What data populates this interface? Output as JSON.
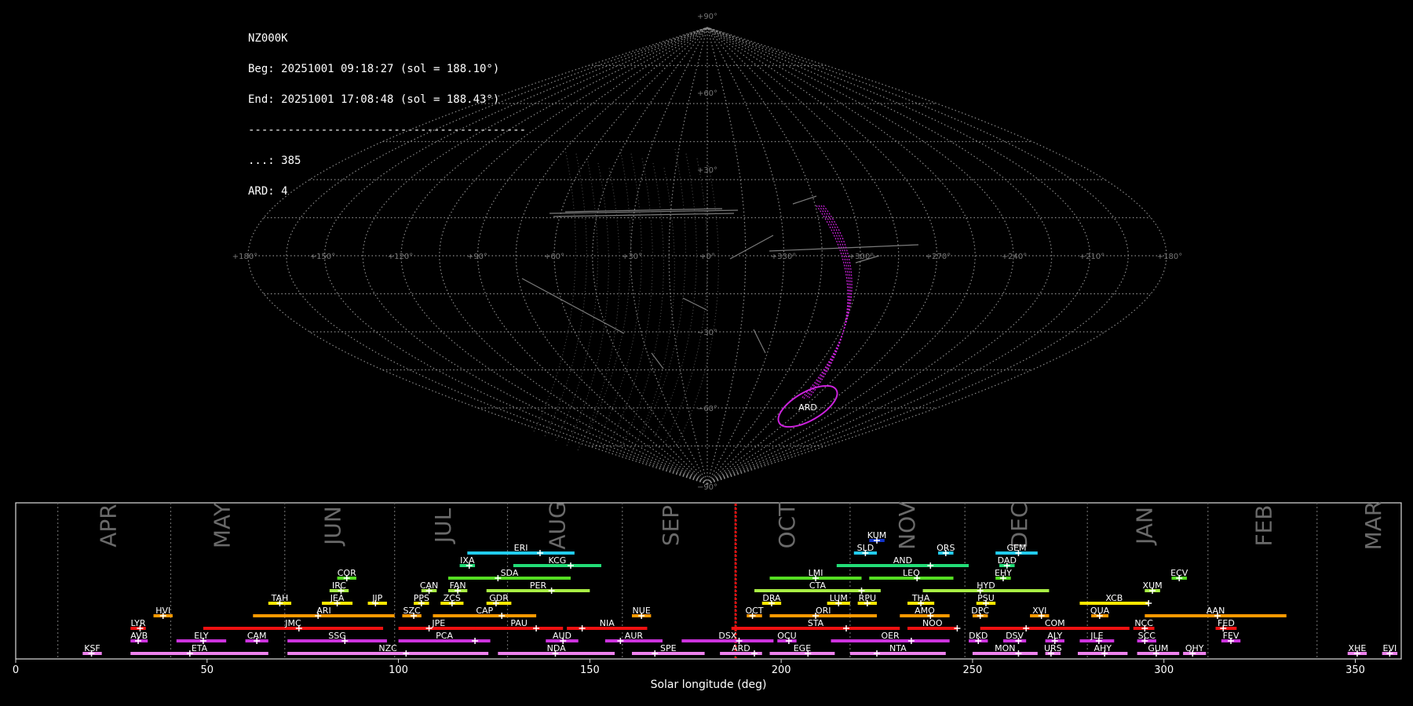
{
  "station": "NZ000K",
  "begin_line": "Beg: 20251001 09:18:27 (sol = 188.10°)",
  "end_line": "End: 20251001 17:08:48 (sol = 188.43°)",
  "separator": "------------------------------------------",
  "count_lines": [
    "...: 385",
    "ARD: 4"
  ],
  "colors": {
    "background": "#000000",
    "grid": "#8a8a8a",
    "tracks": "#9a9a9a",
    "ard": "#cc22dd",
    "current_sol": "#dd1111",
    "month": "#6a6a6a"
  },
  "chart_data": [
    {
      "type": "scatter",
      "projection": "sinusoidal sky map",
      "lon_ticks": [
        "+180°",
        "+150°",
        "+120°",
        "+90°",
        "+60°",
        "+30°",
        "+0°",
        "+330°",
        "+300°",
        "+270°",
        "+240°",
        "+210°",
        "+180°"
      ],
      "lat_ticks": [
        "+90°",
        "+60°",
        "+30°",
        "−30°",
        "−60°",
        "−90°"
      ],
      "grid": true,
      "highlighted_shower": {
        "code": "ARD",
        "ra_deg": 335,
        "dec_deg": -61,
        "count": 4
      },
      "meteor_count": 385
    },
    {
      "type": "bar",
      "title": "",
      "xlabel": "Solar longitude (deg)",
      "ylabel": "",
      "xlim": [
        0,
        362
      ],
      "x_ticks": [
        0,
        50,
        100,
        150,
        200,
        250,
        300,
        350
      ],
      "month_labels": [
        {
          "name": "APR",
          "sol": 24.5
        },
        {
          "name": "MAY",
          "sol": 54.2
        },
        {
          "name": "JUN",
          "sol": 83.2
        },
        {
          "name": "JUL",
          "sol": 112
        },
        {
          "name": "AUG",
          "sol": 141.8
        },
        {
          "name": "SEP",
          "sol": 171.5
        },
        {
          "name": "OCT",
          "sol": 201.8
        },
        {
          "name": "NOV",
          "sol": 233.2
        },
        {
          "name": "DEC",
          "sol": 262.5
        },
        {
          "name": "JAN",
          "sol": 295.2
        },
        {
          "name": "FEB",
          "sol": 326.4
        },
        {
          "name": "MAR",
          "sol": 355
        }
      ],
      "month_boundaries": [
        11,
        40.5,
        70.3,
        99,
        128.5,
        158.5,
        188,
        218,
        248,
        280,
        311.5,
        340
      ],
      "current_sol": 188.1,
      "series": [
        {
          "code": "KSF",
          "row": 0,
          "start": 17.5,
          "end": 22.5,
          "peak": 19.8,
          "color": "#ee82ee"
        },
        {
          "code": "ETA",
          "row": 0,
          "start": 30,
          "end": 66,
          "peak": 45.5,
          "color": "#ee82ee"
        },
        {
          "code": "NZC",
          "row": 0,
          "start": 71,
          "end": 123.5,
          "peak": 102,
          "color": "#ee82ee"
        },
        {
          "code": "NDA",
          "row": 0,
          "start": 126,
          "end": 156.5,
          "peak": 141,
          "color": "#ee82ee"
        },
        {
          "code": "SPE",
          "row": 0,
          "start": 161,
          "end": 180,
          "peak": 167,
          "color": "#ee82ee"
        },
        {
          "code": "ARD",
          "row": 0,
          "start": 184,
          "end": 195,
          "peak": 193,
          "color": "#ee82ee"
        },
        {
          "code": "EGE",
          "row": 0,
          "start": 197,
          "end": 214,
          "peak": 207,
          "color": "#ee82ee"
        },
        {
          "code": "NTA",
          "row": 0,
          "start": 218,
          "end": 243,
          "peak": 225,
          "color": "#ee82ee"
        },
        {
          "code": "MON",
          "row": 0,
          "start": 250,
          "end": 267,
          "peak": 262,
          "color": "#ee82ee"
        },
        {
          "code": "URS",
          "row": 0,
          "start": 269,
          "end": 273,
          "peak": 270.5,
          "color": "#ee82ee"
        },
        {
          "code": "AHY",
          "row": 0,
          "start": 277.5,
          "end": 290.5,
          "peak": 284.5,
          "color": "#ee82ee"
        },
        {
          "code": "GUM",
          "row": 0,
          "start": 293,
          "end": 304,
          "peak": 298,
          "color": "#ee82ee"
        },
        {
          "code": "QHY",
          "row": 0,
          "start": 305,
          "end": 311,
          "peak": 307.5,
          "color": "#ee82ee"
        },
        {
          "code": "XHE",
          "row": 0,
          "start": 348,
          "end": 353,
          "peak": 350.5,
          "color": "#ee82ee"
        },
        {
          "code": "EVI",
          "row": 0,
          "start": 357,
          "end": 361,
          "peak": 359,
          "color": "#ee82ee"
        },
        {
          "code": "AVB",
          "row": 1,
          "start": 30,
          "end": 34.5,
          "peak": 32,
          "color": "#cc33dd"
        },
        {
          "code": "ELY",
          "row": 1,
          "start": 42,
          "end": 55,
          "peak": 49,
          "color": "#cc33dd"
        },
        {
          "code": "CAM",
          "row": 1,
          "start": 60,
          "end": 66,
          "peak": 63,
          "color": "#cc33dd"
        },
        {
          "code": "SSG",
          "row": 1,
          "start": 71,
          "end": 97,
          "peak": 86,
          "color": "#cc33dd"
        },
        {
          "code": "PCA",
          "row": 1,
          "start": 100,
          "end": 124,
          "peak": 120,
          "color": "#cc33dd"
        },
        {
          "code": "AUD",
          "row": 1,
          "start": 138.5,
          "end": 147,
          "peak": 143,
          "color": "#cc33dd"
        },
        {
          "code": "AUR",
          "row": 1,
          "start": 154,
          "end": 169,
          "peak": 158,
          "color": "#cc33dd"
        },
        {
          "code": "DSX",
          "row": 1,
          "start": 174,
          "end": 198,
          "peak": 189,
          "color": "#cc33dd"
        },
        {
          "code": "OCU",
          "row": 1,
          "start": 199,
          "end": 204,
          "peak": 202,
          "color": "#cc33dd"
        },
        {
          "code": "OER",
          "row": 1,
          "start": 213,
          "end": 244,
          "peak": 234,
          "color": "#cc33dd"
        },
        {
          "code": "DKD",
          "row": 1,
          "start": 249,
          "end": 254,
          "peak": 251.5,
          "color": "#cc33dd"
        },
        {
          "code": "DSV",
          "row": 1,
          "start": 258,
          "end": 264,
          "peak": 262,
          "color": "#cc33dd"
        },
        {
          "code": "ALY",
          "row": 1,
          "start": 269,
          "end": 274,
          "peak": 271.5,
          "color": "#cc33dd"
        },
        {
          "code": "JLE",
          "row": 1,
          "start": 278,
          "end": 287,
          "peak": 283,
          "color": "#cc33dd"
        },
        {
          "code": "SCC",
          "row": 1,
          "start": 293,
          "end": 298,
          "peak": 295,
          "color": "#cc33dd"
        },
        {
          "code": "FEV",
          "row": 1,
          "start": 315,
          "end": 320,
          "peak": 317.5,
          "color": "#cc33dd"
        },
        {
          "code": "LYR",
          "row": 2,
          "start": 30,
          "end": 34,
          "peak": 32.5,
          "color": "#ee1111"
        },
        {
          "code": "JMC",
          "row": 2,
          "start": 49,
          "end": 96,
          "peak": 74,
          "color": "#ee1111"
        },
        {
          "code": "JPE",
          "row": 2,
          "start": 100,
          "end": 121,
          "peak": 108,
          "color": "#ee1111"
        },
        {
          "code": "PAU",
          "row": 2,
          "start": 120,
          "end": 143,
          "peak": 136,
          "color": "#ee1111"
        },
        {
          "code": "NIA",
          "row": 2,
          "start": 144,
          "end": 165,
          "peak": 148,
          "color": "#ee1111"
        },
        {
          "code": "STA",
          "row": 2,
          "start": 187,
          "end": 231,
          "peak": 217,
          "color": "#ee1111"
        },
        {
          "code": "NOO",
          "row": 2,
          "start": 233,
          "end": 246,
          "peak": 246,
          "color": "#ee1111"
        },
        {
          "code": "COM",
          "row": 2,
          "start": 252,
          "end": 291,
          "peak": 264,
          "color": "#ee1111"
        },
        {
          "code": "NCC",
          "row": 2,
          "start": 292,
          "end": 297.5,
          "peak": 295,
          "color": "#ee1111"
        },
        {
          "code": "FED",
          "row": 2,
          "start": 313.5,
          "end": 319,
          "peak": 315.5,
          "color": "#ee1111"
        },
        {
          "code": "HVI",
          "row": 3,
          "start": 36,
          "end": 41,
          "peak": 38.5,
          "color": "#ff9a00"
        },
        {
          "code": "ARI",
          "row": 3,
          "start": 62,
          "end": 99,
          "peak": 79,
          "color": "#ff9a00"
        },
        {
          "code": "SZC",
          "row": 3,
          "start": 101,
          "end": 106,
          "peak": 104,
          "color": "#ff9a00"
        },
        {
          "code": "CAP",
          "row": 3,
          "start": 109,
          "end": 136,
          "peak": 127,
          "color": "#ff9a00"
        },
        {
          "code": "NUE",
          "row": 3,
          "start": 161,
          "end": 166,
          "peak": 163.5,
          "color": "#ff9a00"
        },
        {
          "code": "OCT",
          "row": 3,
          "start": 191,
          "end": 195,
          "peak": 192.5,
          "color": "#ff9a00"
        },
        {
          "code": "ORI",
          "row": 3,
          "start": 197,
          "end": 225,
          "peak": 209,
          "color": "#ff9a00"
        },
        {
          "code": "AMO",
          "row": 3,
          "start": 231,
          "end": 244,
          "peak": 239,
          "color": "#ff9a00"
        },
        {
          "code": "DPC",
          "row": 3,
          "start": 250,
          "end": 254,
          "peak": 252,
          "color": "#ff9a00"
        },
        {
          "code": "XVI",
          "row": 3,
          "start": 265,
          "end": 270,
          "peak": 268,
          "color": "#ff9a00"
        },
        {
          "code": "QUA",
          "row": 3,
          "start": 281,
          "end": 285.5,
          "peak": 283.2,
          "color": "#ff9a00"
        },
        {
          "code": "AAN",
          "row": 3,
          "start": 295,
          "end": 332,
          "peak": 314,
          "color": "#ff9a00"
        },
        {
          "code": "TAH",
          "row": 4,
          "start": 66,
          "end": 72,
          "peak": 69,
          "color": "#ffe800"
        },
        {
          "code": "JEA",
          "row": 4,
          "start": 80,
          "end": 88,
          "peak": 84,
          "color": "#ffe800"
        },
        {
          "code": "JIP",
          "row": 4,
          "start": 92,
          "end": 97,
          "peak": 94,
          "color": "#ffe800"
        },
        {
          "code": "PPS",
          "row": 4,
          "start": 104,
          "end": 108,
          "peak": 106,
          "color": "#ffe800"
        },
        {
          "code": "ZCS",
          "row": 4,
          "start": 111,
          "end": 117,
          "peak": 114,
          "color": "#ffe800"
        },
        {
          "code": "GDR",
          "row": 4,
          "start": 123,
          "end": 129.5,
          "peak": 125.5,
          "color": "#ffe800"
        },
        {
          "code": "DRA",
          "row": 4,
          "start": 195,
          "end": 200,
          "peak": 197.5,
          "color": "#ffe800"
        },
        {
          "code": "LUM",
          "row": 4,
          "start": 212,
          "end": 218,
          "peak": 215,
          "color": "#ffe800"
        },
        {
          "code": "RPU",
          "row": 4,
          "start": 220,
          "end": 225,
          "peak": 222.5,
          "color": "#ffe800"
        },
        {
          "code": "THA",
          "row": 4,
          "start": 233,
          "end": 240,
          "peak": 236.5,
          "color": "#ffe800"
        },
        {
          "code": "PSU",
          "row": 4,
          "start": 251,
          "end": 256,
          "peak": 253.5,
          "color": "#ffe800"
        },
        {
          "code": "XCB",
          "row": 4,
          "start": 278,
          "end": 296,
          "peak": 296,
          "color": "#ffe800"
        },
        {
          "code": "IRC",
          "row": 5,
          "start": 82,
          "end": 87,
          "peak": 85,
          "color": "#a8ee44"
        },
        {
          "code": "CAN",
          "row": 5,
          "start": 106,
          "end": 110,
          "peak": 108,
          "color": "#a8ee44"
        },
        {
          "code": "FAN",
          "row": 5,
          "start": 113,
          "end": 118,
          "peak": 115.5,
          "color": "#a8ee44"
        },
        {
          "code": "PER",
          "row": 5,
          "start": 123,
          "end": 150,
          "peak": 140,
          "color": "#a8ee44"
        },
        {
          "code": "CTA",
          "row": 5,
          "start": 193,
          "end": 226,
          "peak": 221,
          "color": "#a8ee44"
        },
        {
          "code": "HYD",
          "row": 5,
          "start": 237,
          "end": 270,
          "peak": 252,
          "color": "#a8ee44"
        },
        {
          "code": "XUM",
          "row": 5,
          "start": 295,
          "end": 299,
          "peak": 297,
          "color": "#a8ee44"
        },
        {
          "code": "COR",
          "row": 6,
          "start": 84,
          "end": 89,
          "peak": 86.5,
          "color": "#55dd22"
        },
        {
          "code": "SDA",
          "row": 6,
          "start": 113,
          "end": 145,
          "peak": 126,
          "color": "#55dd22"
        },
        {
          "code": "LMI",
          "row": 6,
          "start": 197,
          "end": 221,
          "peak": 209,
          "color": "#55dd22"
        },
        {
          "code": "LEO",
          "row": 6,
          "start": 223,
          "end": 245,
          "peak": 235.5,
          "color": "#55dd22"
        },
        {
          "code": "EHY",
          "row": 6,
          "start": 256,
          "end": 260,
          "peak": 258,
          "color": "#55dd22"
        },
        {
          "code": "ECV",
          "row": 6,
          "start": 302,
          "end": 306,
          "peak": 304,
          "color": "#55dd22"
        },
        {
          "code": "IXA",
          "row": 7,
          "start": 116,
          "end": 120,
          "peak": 118.5,
          "color": "#22dd77"
        },
        {
          "code": "KCG",
          "row": 7,
          "start": 130,
          "end": 153,
          "peak": 145,
          "color": "#22dd77"
        },
        {
          "code": "AND",
          "row": 7,
          "start": 214.5,
          "end": 249,
          "peak": 239,
          "color": "#22dd77"
        },
        {
          "code": "DAD",
          "row": 7,
          "start": 257,
          "end": 261,
          "peak": 259,
          "color": "#22dd77"
        },
        {
          "code": "ERI",
          "row": 8,
          "start": 118,
          "end": 146,
          "peak": 137,
          "color": "#22ccee"
        },
        {
          "code": "SLD",
          "row": 8,
          "start": 219,
          "end": 225,
          "peak": 222,
          "color": "#22ccee"
        },
        {
          "code": "ORS",
          "row": 8,
          "start": 241,
          "end": 245,
          "peak": 243,
          "color": "#22ccee"
        },
        {
          "code": "GEM",
          "row": 8,
          "start": 256,
          "end": 267,
          "peak": 262,
          "color": "#22ccee"
        },
        {
          "code": "KUM",
          "row": 9,
          "start": 223,
          "end": 227,
          "peak": 225,
          "color": "#1133cc"
        }
      ]
    }
  ]
}
